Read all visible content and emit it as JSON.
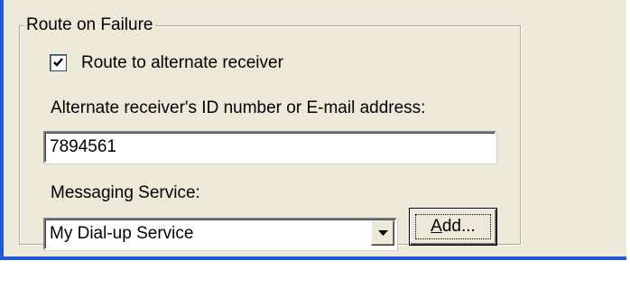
{
  "group": {
    "title": "Route on Failure"
  },
  "route_checkbox": {
    "label": "Route to alternate receiver",
    "checked": true
  },
  "alternate_receiver": {
    "label": "Alternate receiver's ID number or E-mail address:",
    "value": "7894561"
  },
  "messaging_service": {
    "label": "Messaging Service:",
    "selected": "My Dial-up Service"
  },
  "buttons": {
    "add_label": "Add...",
    "add_accesskey": "A",
    "add_rest": "dd..."
  },
  "icons": {
    "check": "checkmark-icon",
    "dropdown": "chevron-down-icon"
  },
  "colors": {
    "dialog_bg": "#ece9d8",
    "window_border": "#1f5ad3",
    "groupbox_line": "#aca899"
  }
}
